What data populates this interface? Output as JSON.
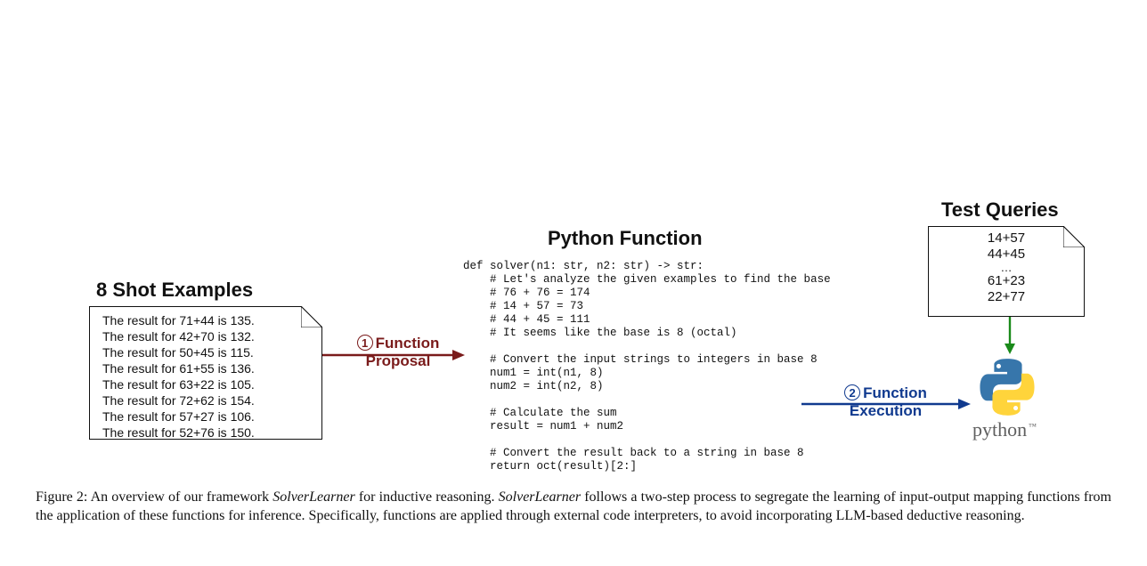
{
  "headings": {
    "examples": "8 Shot Examples",
    "pyfn": "Python Function",
    "queries": "Test Queries"
  },
  "examples": [
    "The result for 71+44 is 135.",
    "The result for 42+70 is 132.",
    "The result for 50+45 is 115.",
    "The result for 61+55 is 136.",
    "The result for 63+22 is 105.",
    "The result for 72+62 is 154.",
    "The result for 57+27 is 106.",
    "The result for 52+76 is 150."
  ],
  "queries": [
    "14+57",
    "44+45",
    "…",
    "61+23",
    "22+77"
  ],
  "step1": {
    "num": "1",
    "top": "Function",
    "bot": "Proposal"
  },
  "step2": {
    "num": "2",
    "top": "Function",
    "bot": "Execution"
  },
  "code": "def solver(n1: str, n2: str) -> str:\n    # Let's analyze the given examples to find the base\n    # 76 + 76 = 174\n    # 14 + 57 = 73\n    # 44 + 45 = 111\n    # It seems like the base is 8 (octal)\n\n    # Convert the input strings to integers in base 8\n    num1 = int(n1, 8)\n    num2 = int(n2, 8)\n\n    # Calculate the sum\n    result = num1 + num2\n\n    # Convert the result back to a string in base 8\n    return oct(result)[2:]",
  "python_label": {
    "word": "python",
    "tm": "™"
  },
  "caption": {
    "lead": "Figure 2:",
    "t1": " An overview of our framework ",
    "sl1": "SolverLearner",
    "t2": " for inductive reasoning. ",
    "sl2": "SolverLearner",
    "t3": " follows a two-step process to segregate the learning of input-output mapping functions from the application of these functions for inference. Specifically, functions are applied through external code interpreters, to avoid incorporating LLM-based deductive reasoning."
  },
  "colors": {
    "step1": "#7a1b1b",
    "step2": "#103a8f",
    "arrow_green": "#1a8a1a"
  }
}
